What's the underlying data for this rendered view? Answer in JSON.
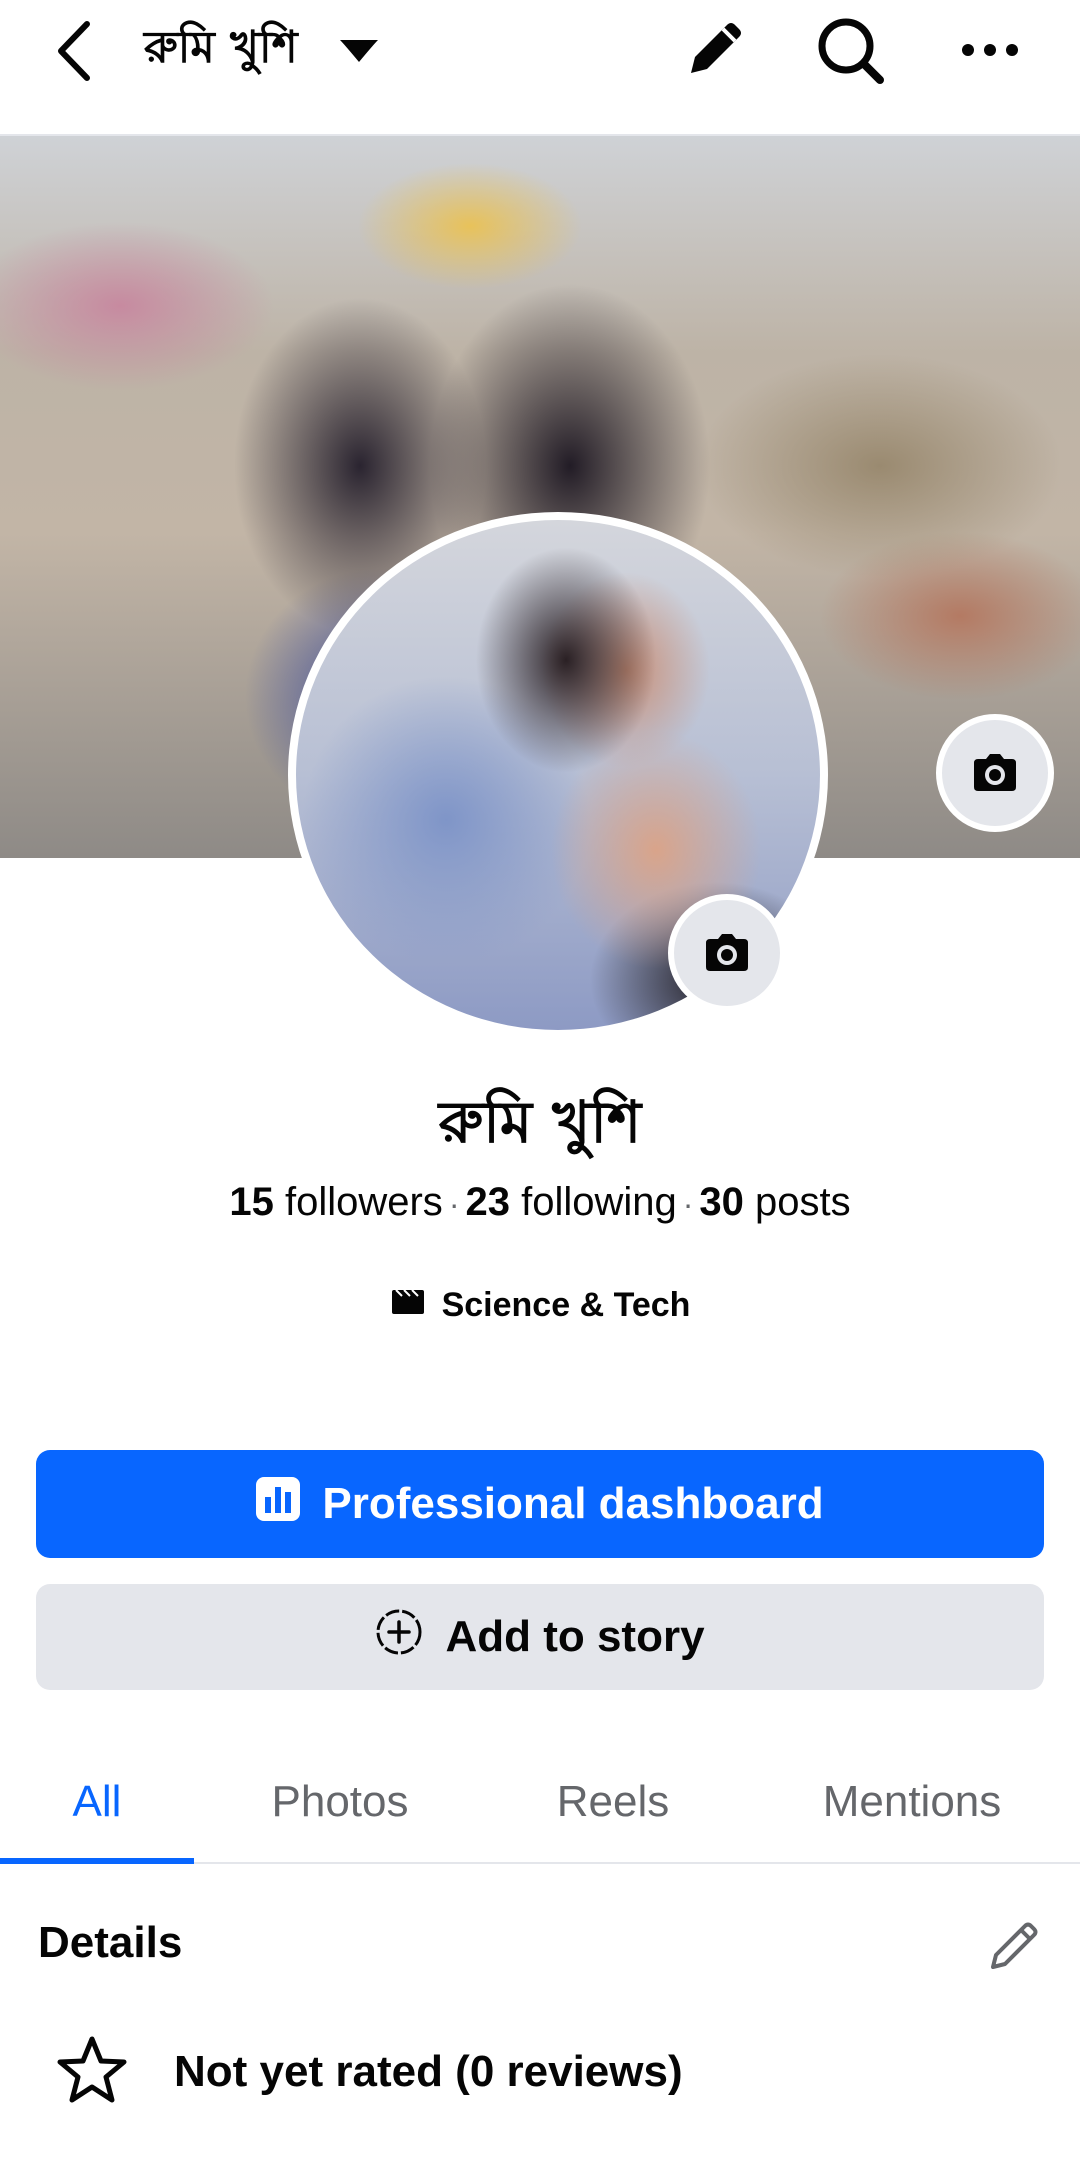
{
  "header": {
    "title": "রুমি খুশি",
    "icons": [
      "back-arrow-icon",
      "caret-down-icon",
      "pencil-icon",
      "search-icon",
      "more-icon"
    ]
  },
  "profile": {
    "name": "রুমি খুশি",
    "followers_count": "15",
    "followers_label": "followers",
    "following_count": "23",
    "following_label": "following",
    "posts_count": "30",
    "posts_label": "posts",
    "category": "Science & Tech",
    "separator": "·"
  },
  "actions": {
    "primary_label": "Professional dashboard",
    "secondary_label": "Add to story"
  },
  "tabs": [
    {
      "label": "All",
      "active": true
    },
    {
      "label": "Photos",
      "active": false
    },
    {
      "label": "Reels",
      "active": false
    },
    {
      "label": "Mentions",
      "active": false
    }
  ],
  "details": {
    "title": "Details",
    "rating_text": "Not yet rated (0 reviews)"
  },
  "colors": {
    "accent": "#0866ff",
    "secondary_button": "#e4e6eb",
    "muted_text": "#65676b"
  }
}
